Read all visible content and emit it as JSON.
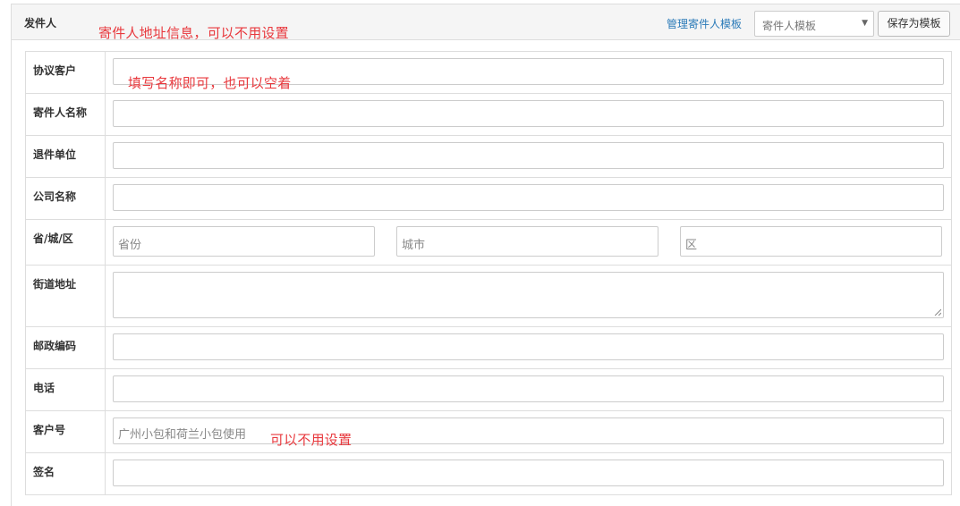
{
  "header": {
    "title": "发件人",
    "annotation": "寄件人地址信息，可以不用设置",
    "manage_link": "管理寄件人模板",
    "template_select": {
      "selected": "寄件人模板"
    },
    "save_button": "保存为模板"
  },
  "rows": [
    {
      "label": "协议客户",
      "annotation": "填写名称即可，也可以空着"
    },
    {
      "label": "寄件人名称"
    },
    {
      "label": "退件单位"
    },
    {
      "label": "公司名称"
    },
    {
      "label": "省/城/区",
      "placeholders": [
        "省份",
        "城市",
        "区"
      ]
    },
    {
      "label": "街道地址"
    },
    {
      "label": "邮政编码"
    },
    {
      "label": "电话"
    },
    {
      "label": "客户号",
      "placeholder": "广州小包和荷兰小包使用",
      "annotation": "可以不用设置"
    },
    {
      "label": "签名"
    }
  ],
  "colors": {
    "annotation": "#e8383d",
    "link": "#2a7ab8",
    "border": "#dddddd"
  }
}
